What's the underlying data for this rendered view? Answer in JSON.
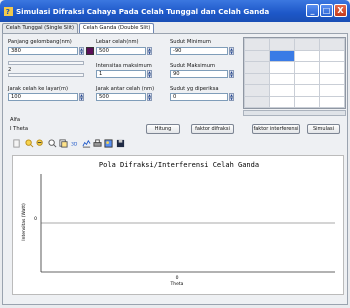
{
  "window": {
    "title": "Simulasi Difraksi Cahaya Pada Celah Tunggal dan Celah Ganda",
    "minimize": "_",
    "maximize": "□",
    "close": "X"
  },
  "tabs": [
    {
      "label": "Celah Tunggal (Single Slit)"
    },
    {
      "label": "Celah Ganda (Double Slit)"
    }
  ],
  "form": {
    "wavelength_label": "Panjang gelombang(nm)",
    "wavelength_value": "380",
    "slit_width_label": "Lebar celah(nm)",
    "slit_width_value": "500",
    "min_angle_label": "Sudut Minimum",
    "min_angle_value": "-90",
    "slider_value": "2",
    "max_intensity_label": "Intensitas maksimum",
    "max_intensity_value": "1",
    "max_angle_label": "Sudut Maksimum",
    "max_angle_value": "90",
    "screen_distance_label": "Jarak celah ke layar(m)",
    "screen_distance_value": "100",
    "slit_distance_label": "Jarak antar celah (nm)",
    "slit_distance_value": "500",
    "angle_label": "Sudut yg diperiksa",
    "angle_value": "0",
    "swatch_color": "#5b0e59"
  },
  "results": {
    "alfa_label": "Alfa",
    "itheta_label": "I Theta"
  },
  "buttons": {
    "hitung": "Hitung",
    "faktor_difraksi": "faktor difraksi",
    "faktor_interferensi": "faktor interferensi",
    "simulasi": "Simulasi"
  },
  "toolbar": [
    "page-icon",
    "zoom-in-icon",
    "zoom-out-icon",
    "zoom-icon",
    "page-copy-icon",
    "3d-icon",
    "chart-icon",
    "print-icon",
    "picture-icon",
    "save-icon"
  ],
  "chart_data": {
    "type": "line",
    "title": "Pola Difraksi/Interferensi Celah Ganda",
    "xlabel": "Theta",
    "ylabel": "Intensitas (Watt)",
    "x_tick": "0",
    "y_tick": "0",
    "series": [
      {
        "x": [
          -90,
          90
        ],
        "values": [
          0,
          0
        ]
      }
    ]
  }
}
